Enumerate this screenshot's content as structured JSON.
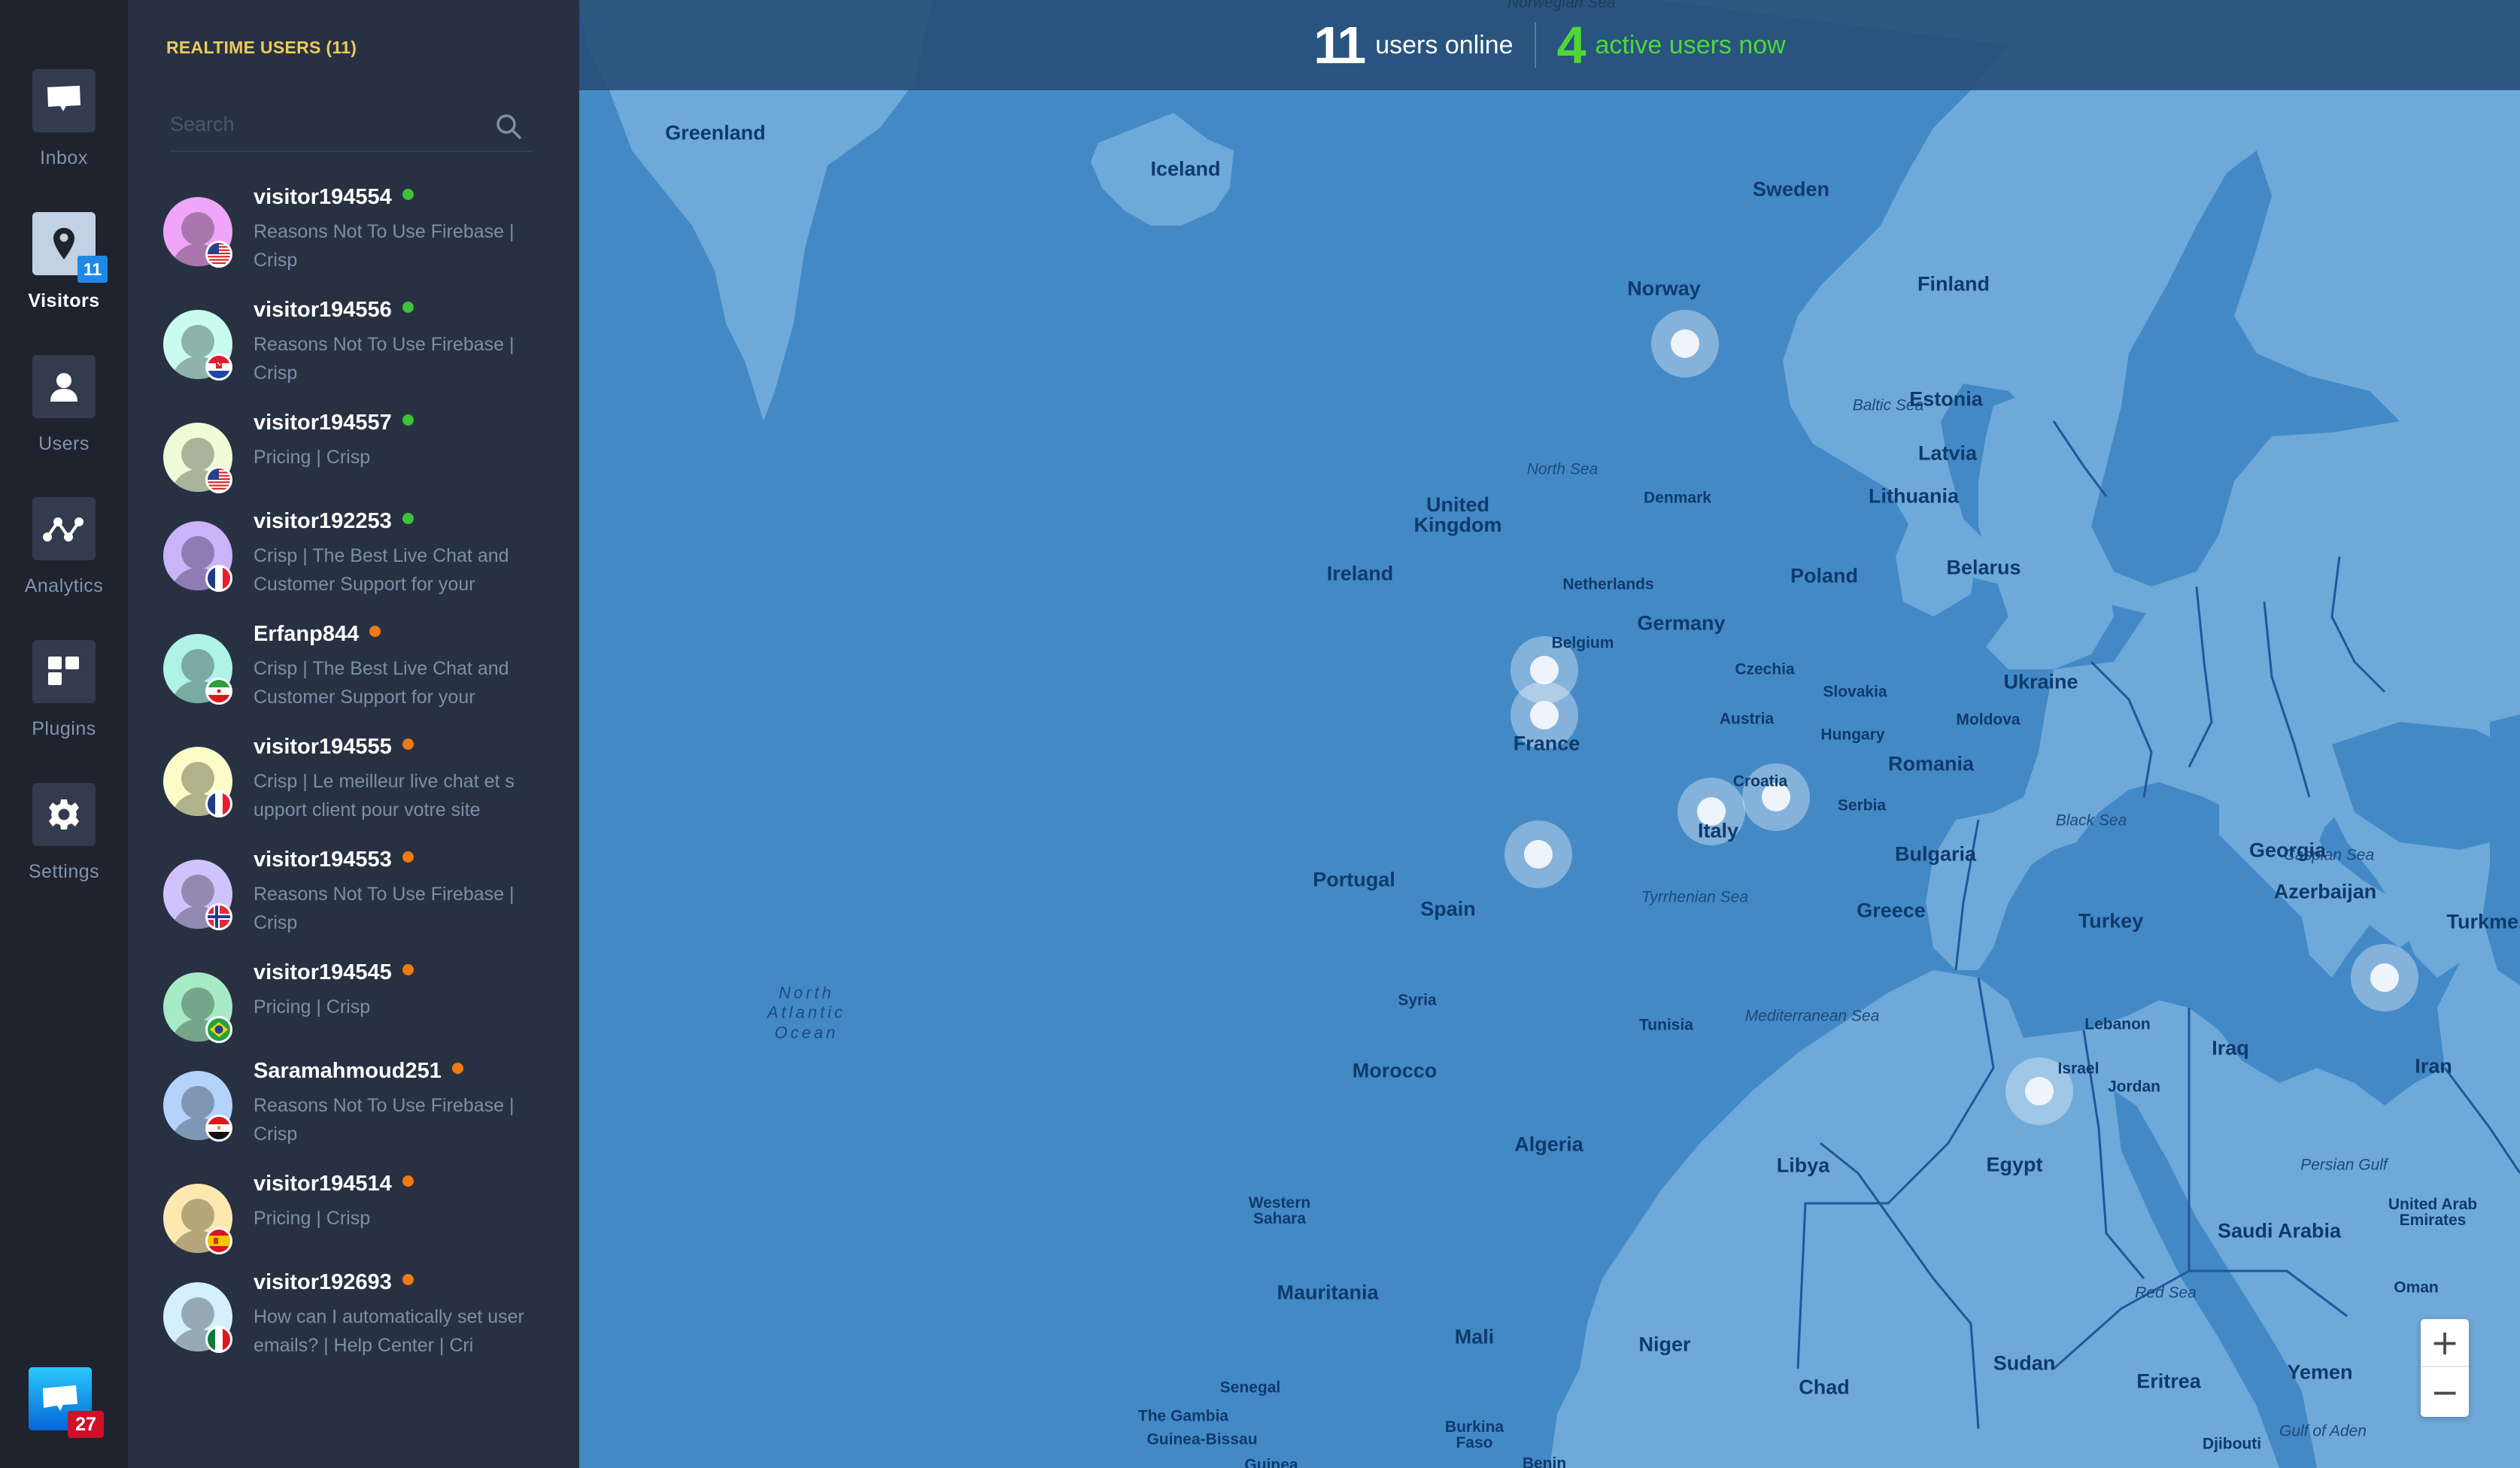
{
  "nav": {
    "items": [
      {
        "id": "inbox",
        "label": "Inbox",
        "icon": "chat-bubble-icon",
        "active": false
      },
      {
        "id": "visitors",
        "label": "Visitors",
        "icon": "map-pin-icon",
        "active": true,
        "badge": "11"
      },
      {
        "id": "users",
        "label": "Users",
        "icon": "user-icon",
        "active": false
      },
      {
        "id": "analytics",
        "label": "Analytics",
        "icon": "analytics-icon",
        "active": false
      },
      {
        "id": "plugins",
        "label": "Plugins",
        "icon": "plugins-icon",
        "active": false
      },
      {
        "id": "settings",
        "label": "Settings",
        "icon": "gear-icon",
        "active": false
      }
    ],
    "chat_launcher": {
      "icon": "chat-bubble-icon",
      "badge": "27"
    }
  },
  "panel": {
    "title": "REALTIME USERS (11)",
    "search": {
      "placeholder": "Search",
      "value": ""
    },
    "status_colors": {
      "active": "#3dc23a",
      "idle": "#f07a10"
    },
    "visitors": [
      {
        "name": "visitor194554",
        "status": "active",
        "page": "Reasons Not To Use Firebase | Crisp",
        "country": "us",
        "avatar_color": "#efa5f8",
        "avatar_shade": "#a976ad"
      },
      {
        "name": "visitor194556",
        "status": "active",
        "page": "Reasons Not To Use Firebase | Crisp",
        "country": "hr",
        "avatar_color": "#c8fcee",
        "avatar_shade": "#8db3aa"
      },
      {
        "name": "visitor194557",
        "status": "active",
        "page": "Pricing | Crisp",
        "country": "us",
        "avatar_color": "#eefdd8",
        "avatar_shade": "#a9b59b"
      },
      {
        "name": "visitor192253",
        "status": "active",
        "page": "Crisp | The Best Live Chat and Customer Support for your",
        "country": "fr",
        "avatar_color": "#cbb3f9",
        "avatar_shade": "#8f7cb3"
      },
      {
        "name": "Erfanp844",
        "status": "idle",
        "page": "Crisp | The Best Live Chat and Customer Support for your",
        "country": "ir",
        "avatar_color": "#aef3e4",
        "avatar_shade": "#7aaaa0"
      },
      {
        "name": "visitor194555",
        "status": "idle",
        "page": "Crisp | Le meilleur live chat et support client pour votre site",
        "country": "fr",
        "avatar_color": "#fbfcc8",
        "avatar_shade": "#b0b28b"
      },
      {
        "name": "visitor194553",
        "status": "idle",
        "page": "Reasons Not To Use Firebase | Crisp",
        "country": "no",
        "avatar_color": "#d0c3fb",
        "avatar_shade": "#928ab1"
      },
      {
        "name": "visitor194545",
        "status": "idle",
        "page": "Pricing | Crisp",
        "country": "br",
        "avatar_color": "#a7eac6",
        "avatar_shade": "#75a58b"
      },
      {
        "name": "Saramahmoud251",
        "status": "idle",
        "page": "Reasons Not To Use Firebase | Crisp",
        "country": "eg",
        "avatar_color": "#b3d3fb",
        "avatar_shade": "#7f96b5"
      },
      {
        "name": "visitor194514",
        "status": "idle",
        "page": "Pricing | Crisp",
        "country": "es",
        "avatar_color": "#fde9b0",
        "avatar_shade": "#b5a67b"
      },
      {
        "name": "visitor192693",
        "status": "idle",
        "page": "How can I automatically set user emails? | Help Center | Cri",
        "country": "it",
        "avatar_color": "#d4f0fd",
        "avatar_shade": "#96aab5"
      }
    ]
  },
  "stats": {
    "online_count": "11",
    "online_label": "users online",
    "active_count": "4",
    "active_label": "active users now",
    "online_color": "#ffffff",
    "active_color": "#4ed837"
  },
  "map": {
    "colors": {
      "sea": "#4389c6",
      "land": "#6ea9d9",
      "border": "#21579a",
      "label": "#0f3a6b"
    },
    "zoom_in_label": "+",
    "zoom_out_label": "−",
    "seas": [
      "Norwegian Sea",
      "North Sea",
      "Baltic Sea",
      "Black Sea",
      "Caspian Sea",
      "Tyrrhenian Sea",
      "Mediterranean Sea",
      "Persian Gulf",
      "Red Sea",
      "Gulf of Aden"
    ],
    "ocean": "North Atlantic Ocean",
    "countries": [
      "Greenland",
      "Iceland",
      "Sweden",
      "Norway",
      "Finland",
      "Estonia",
      "Latvia",
      "Lithuania",
      "Denmark",
      "United Kingdom",
      "Ireland",
      "Netherlands",
      "Belgium",
      "Germany",
      "Poland",
      "Belarus",
      "Czechia",
      "Slovakia",
      "Austria",
      "Hungary",
      "Ukraine",
      "Moldova",
      "Romania",
      "France",
      "Croatia",
      "Serbia",
      "Italy",
      "Bulgaria",
      "Portugal",
      "Spain",
      "Greece",
      "Turkey",
      "Georgia",
      "Azerbaijan",
      "Turkmenistan",
      "Tunisia",
      "Morocco",
      "Algeria",
      "Libya",
      "Egypt",
      "Syria",
      "Lebanon",
      "Israel",
      "Jordan",
      "Iraq",
      "Iran",
      "Western Sahara",
      "Mauritania",
      "Mali",
      "Niger",
      "Chad",
      "Sudan",
      "Eritrea",
      "Yemen",
      "Saudi Arabia",
      "United Arab Emirates",
      "Oman",
      "Djibouti",
      "Senegal",
      "The Gambia",
      "Guinea-Bissau",
      "Guinea",
      "Burkina Faso",
      "Benin"
    ],
    "visitor_markers": [
      "Norway",
      "France (north)",
      "France (center)",
      "Spain (Catalonia)",
      "Italy",
      "Croatia",
      "Egypt",
      "Iran"
    ]
  }
}
